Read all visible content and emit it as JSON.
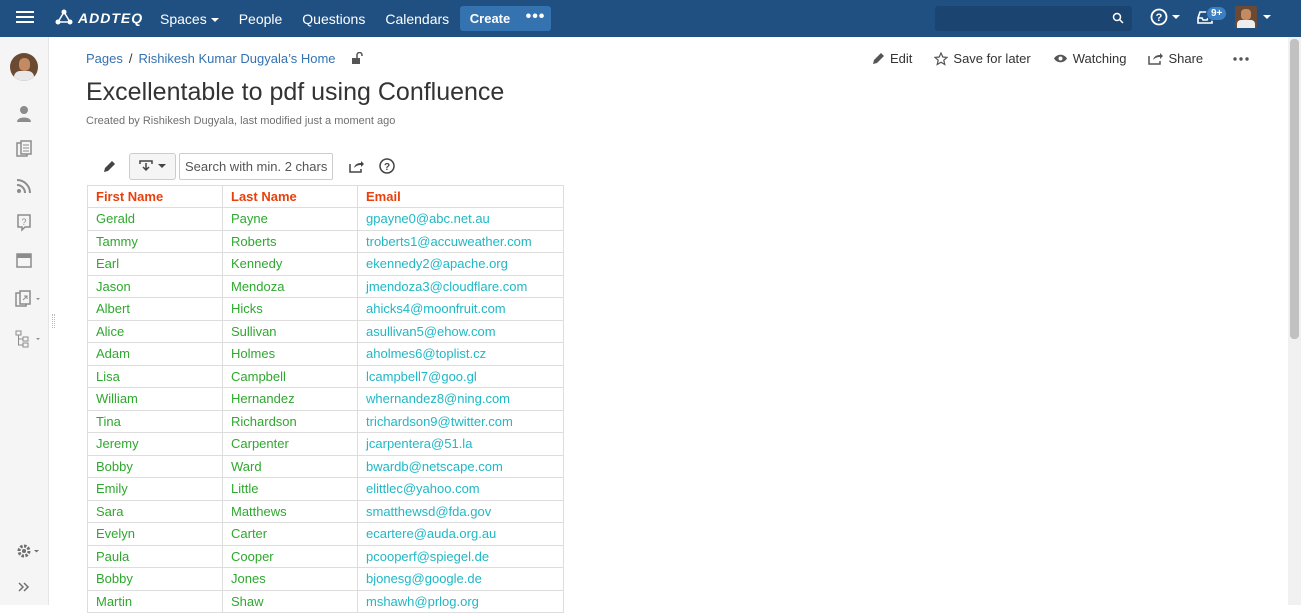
{
  "header": {
    "logo_text": "ADDTEQ",
    "nav": [
      "Spaces",
      "People",
      "Questions",
      "Calendars"
    ],
    "create_label": "Create",
    "create_more": "•••",
    "notifications_badge": "9+",
    "brand_color": "#205081"
  },
  "breadcrumb": {
    "root": "Pages",
    "separator": "/",
    "parent": "Rishikesh Kumar Dugyala’s Home"
  },
  "page_actions": {
    "edit": "Edit",
    "save_for_later": "Save for later",
    "watching": "Watching",
    "share": "Share"
  },
  "page": {
    "title": "Excellentable to pdf using Confluence",
    "byline": "Created by Rishikesh Dugyala, last modified just a moment ago"
  },
  "toolbar": {
    "search_placeholder": "Search with min. 2 chars"
  },
  "table": {
    "headers": [
      "First Name",
      "Last Name",
      "Email"
    ],
    "rows": [
      [
        "Gerald",
        "Payne",
        "gpayne0@abc.net.au"
      ],
      [
        "Tammy",
        "Roberts",
        "troberts1@accuweather.com"
      ],
      [
        "Earl",
        "Kennedy",
        "ekennedy2@apache.org"
      ],
      [
        "Jason",
        "Mendoza",
        "jmendoza3@cloudflare.com"
      ],
      [
        "Albert",
        "Hicks",
        "ahicks4@moonfruit.com"
      ],
      [
        "Alice",
        "Sullivan",
        "asullivan5@ehow.com"
      ],
      [
        "Adam",
        "Holmes",
        "aholmes6@toplist.cz"
      ],
      [
        "Lisa",
        "Campbell",
        "lcampbell7@goo.gl"
      ],
      [
        "William",
        "Hernandez",
        "whernandez8@ning.com"
      ],
      [
        "Tina",
        "Richardson",
        "trichardson9@twitter.com"
      ],
      [
        "Jeremy",
        "Carpenter",
        "jcarpentera@51.la"
      ],
      [
        "Bobby",
        "Ward",
        "bwardb@netscape.com"
      ],
      [
        "Emily",
        "Little",
        "elittlec@yahoo.com"
      ],
      [
        "Sara",
        "Matthews",
        "smatthewsd@fda.gov"
      ],
      [
        "Evelyn",
        "Carter",
        "ecartere@auda.org.au"
      ],
      [
        "Paula",
        "Cooper",
        "pcooperf@spiegel.de"
      ],
      [
        "Bobby",
        "Jones",
        "bjonesg@google.de"
      ],
      [
        "Martin",
        "Shaw",
        "mshawh@prlog.org"
      ]
    ]
  }
}
